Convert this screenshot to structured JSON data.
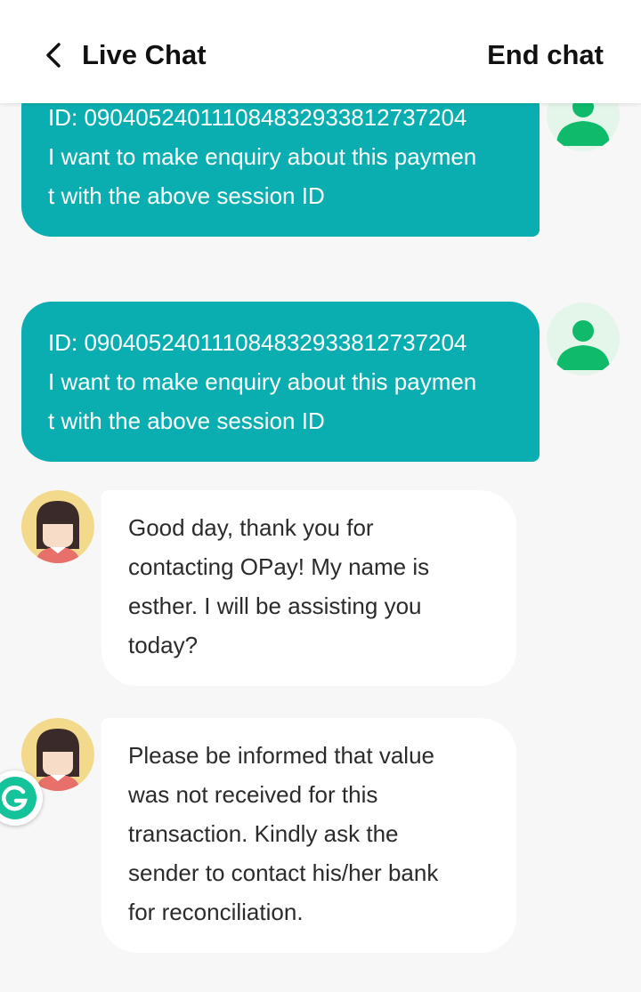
{
  "header": {
    "title": "Live Chat",
    "end_chat_label": "End chat",
    "back_icon": "chevron-left-icon"
  },
  "messages": [
    {
      "sender": "user",
      "text": "ID: 090405240111084832933812737204\nI want to make enquiry about this paymen\nt with the above session ID"
    },
    {
      "sender": "user",
      "text": "ID: 090405240111084832933812737204\nI want to make enquiry about this paymen\nt with the above session ID"
    },
    {
      "sender": "agent",
      "text": "Good day, thank you for\ncontacting OPay! My name is\nesther. I will be assisting you\ntoday?"
    },
    {
      "sender": "agent",
      "text": "Please be informed that value\nwas not received for this\ntransaction. Kindly ask the\nsender to contact his/her bank\nfor reconciliation."
    }
  ],
  "colors": {
    "user_bubble": "#0aaeb1",
    "agent_bubble": "#ffffff",
    "background": "#f7f7f7",
    "user_avatar_icon": "#0fbb6a",
    "grammarly_icon": "#15c39a"
  },
  "floating_widget": {
    "icon": "grammarly-icon"
  }
}
